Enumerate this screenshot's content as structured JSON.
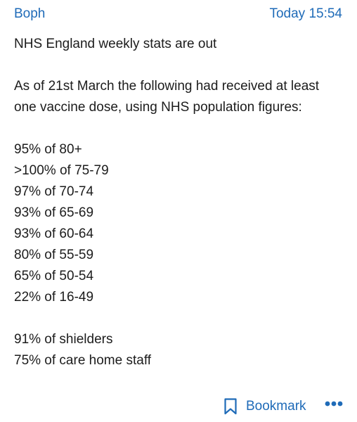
{
  "post": {
    "author": "Boph",
    "timestamp": "Today 15:54",
    "intro": "NHS England weekly stats are out",
    "paragraph": "As of 21st March the following had received at least one vaccine dose, using NHS population figures:",
    "age_stats": [
      "95% of 80+",
      ">100% of 75-79",
      "97% of 70-74",
      "93% of 65-69",
      "93% of 60-64",
      "80% of 55-59",
      "65% of 50-54",
      "22% of 16-49"
    ],
    "group_stats": [
      "91% of shielders",
      "75% of care home staff"
    ]
  },
  "actions": {
    "bookmark_label": "Bookmark",
    "bookmark_icon": "bookmark-icon",
    "more_icon": "more-options-icon"
  },
  "colors": {
    "link_blue": "#1f6bb8",
    "text": "#1c1c1c",
    "background": "#ffffff"
  }
}
